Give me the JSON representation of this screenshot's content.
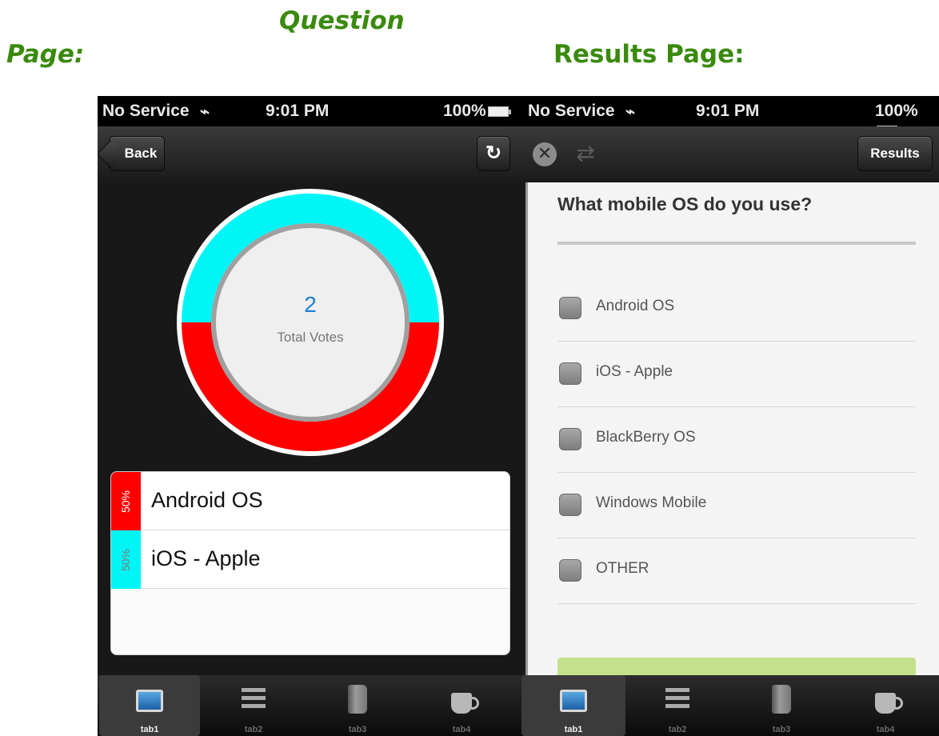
{
  "captions": {
    "question_line1": "Question",
    "question_line2": "Page:",
    "results": "Results Page:"
  },
  "status_bar": {
    "carrier": "No Service",
    "time": "9:01 PM",
    "battery": "100%",
    "wifi_icon": "wifi-icon"
  },
  "left_screen": {
    "nav": {
      "back_label": "Back",
      "refresh_icon": "refresh-icon"
    },
    "summary": {
      "total_votes": "2",
      "total_votes_label": "Total Votes"
    },
    "results": [
      {
        "label": "Android OS",
        "percent": "50%",
        "color": "#ff0000",
        "fraction": 0.5
      },
      {
        "label": "iOS - Apple",
        "percent": "50%",
        "color": "#00f6f6",
        "fraction": 0.5
      }
    ]
  },
  "right_screen": {
    "nav": {
      "results_label": "Results",
      "close_icon": "close-icon",
      "sync_icon": "sync-icon"
    },
    "question": "What mobile OS do you use?",
    "options": [
      "Android OS",
      "iOS - Apple",
      "BlackBerry OS",
      "Windows Mobile",
      "OTHER"
    ]
  },
  "tab_bar": {
    "tabs": [
      {
        "label": "tab1",
        "icon": "tv-icon",
        "active": true
      },
      {
        "label": "tab2",
        "icon": "list-icon",
        "active": false
      },
      {
        "label": "tab3",
        "icon": "book-icon",
        "active": false
      },
      {
        "label": "tab4",
        "icon": "cup-icon",
        "active": false
      }
    ]
  },
  "colors": {
    "caption": "#3a8a0e",
    "android": "#ff0000",
    "ios": "#00f6f6",
    "vote_count": "#1e7fd0",
    "submit_strip": "#c4e08c"
  }
}
